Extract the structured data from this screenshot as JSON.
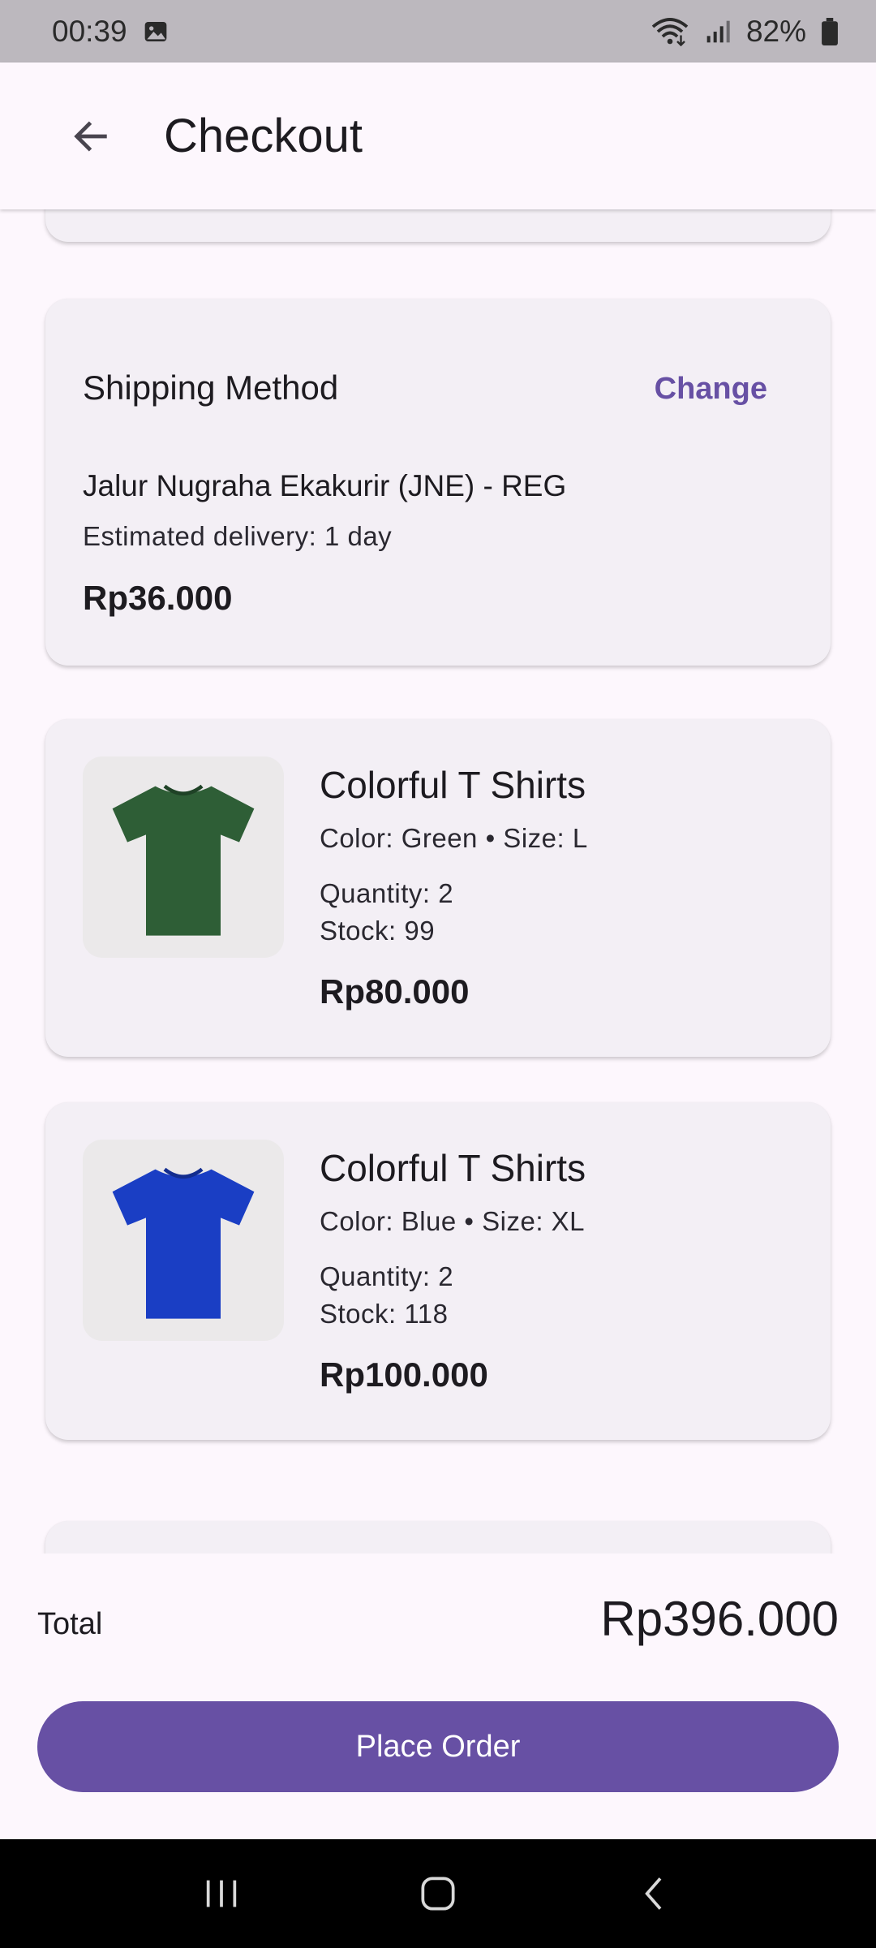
{
  "status_bar": {
    "time": "00:39",
    "battery": "82%",
    "icons": [
      "gallery-icon",
      "wifi-icon",
      "signal-icon",
      "battery-icon"
    ]
  },
  "app_bar": {
    "title": "Checkout",
    "back_icon": "arrow-back-icon"
  },
  "shipping": {
    "title": "Shipping Method",
    "change_label": "Change",
    "courier": "Jalur Nugraha Ekakurir (JNE) - REG",
    "estimate": "Estimated delivery: 1 day",
    "price": "Rp36.000"
  },
  "items": [
    {
      "name": "Colorful T Shirts",
      "variant": "Color: Green • Size: L",
      "quantity": "Quantity: 2",
      "stock": "Stock: 99",
      "price": "Rp80.000",
      "image_color": "#2e5e36"
    },
    {
      "name": "Colorful T Shirts",
      "variant": "Color: Blue • Size: XL",
      "quantity": "Quantity: 2",
      "stock": "Stock: 118",
      "price": "Rp100.000",
      "image_color": "#1a3ec4"
    }
  ],
  "summary": {
    "total_label": "Total",
    "total_value": "Rp396.000",
    "place_order_label": "Place Order"
  },
  "colors": {
    "primary": "#6750a4",
    "surface": "#fdf7fd",
    "card": "#f3eff5"
  },
  "nav_bar": {
    "buttons": [
      "recent-apps-icon",
      "home-icon",
      "back-icon"
    ]
  }
}
